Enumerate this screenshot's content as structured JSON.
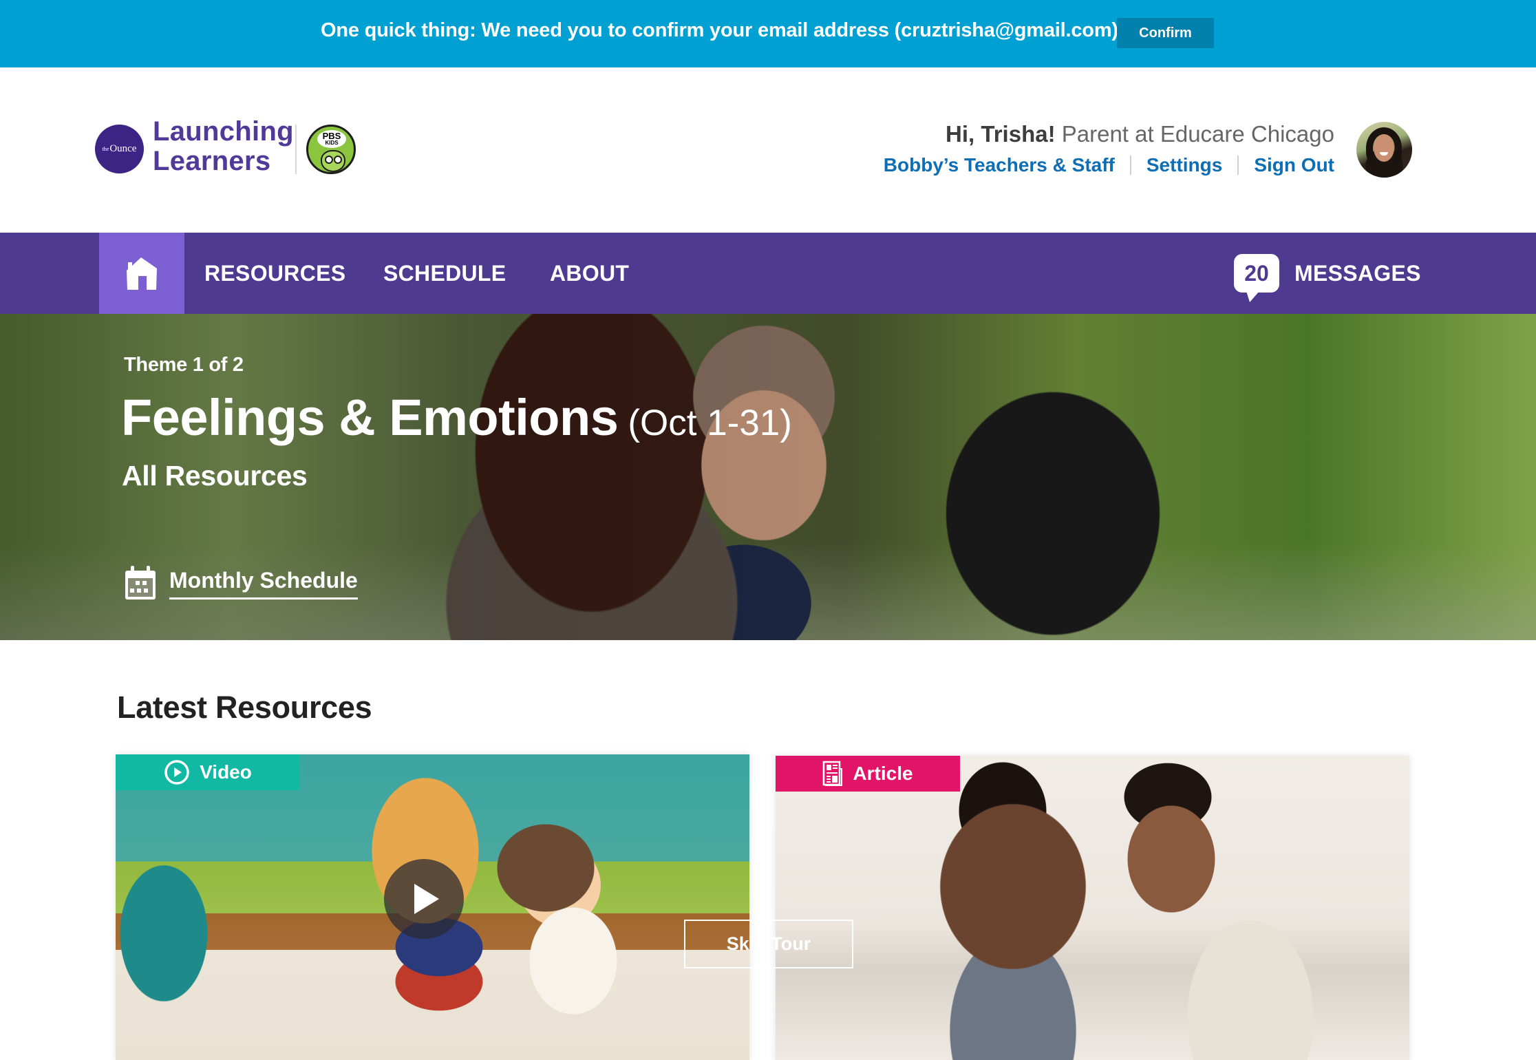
{
  "banner": {
    "message": "One quick thing: We need you to confirm your email address (cruztrisha@gmail.com).",
    "confirm_label": "Confirm"
  },
  "header": {
    "logo_ounce_prefix": "the",
    "logo_ounce": "Ounce",
    "logo_line1": "Launching",
    "logo_line2": "Learners",
    "pbs_line1": "PBS",
    "pbs_line2": "KIDS",
    "greeting_name": "Hi, Trisha!",
    "greeting_role": "Parent at Educare Chicago",
    "links": [
      "Bobby’s Teachers & Staff",
      "Settings",
      "Sign Out"
    ],
    "avatar_icon": "user-avatar"
  },
  "nav": {
    "home_icon": "home-icon",
    "items": [
      "RESOURCES",
      "SCHEDULE",
      "ABOUT"
    ],
    "messages_count": "20",
    "messages_label": "MESSAGES"
  },
  "hero": {
    "kicker": "Theme 1 of 2",
    "title": "Feelings & Emotions",
    "dates": "(Oct 1-31)",
    "subtitle": "All Resources",
    "schedule_link": "Monthly Schedule",
    "schedule_icon": "calendar-icon"
  },
  "latest": {
    "title": "Latest Resources",
    "cards": [
      {
        "type_label": "Video",
        "type_icon": "play-circle-icon",
        "color": "#11B9A3"
      },
      {
        "type_label": "Article",
        "type_icon": "newspaper-icon",
        "color": "#E21468"
      }
    ]
  },
  "tour": {
    "skip_label": "Skip Tour"
  },
  "colors": {
    "banner": "#00A0D3",
    "confirm_button": "#0080AD",
    "brand_purple": "#4F3A91",
    "home_tile": "#7B5FD3",
    "link_blue": "#0D6EB5"
  }
}
